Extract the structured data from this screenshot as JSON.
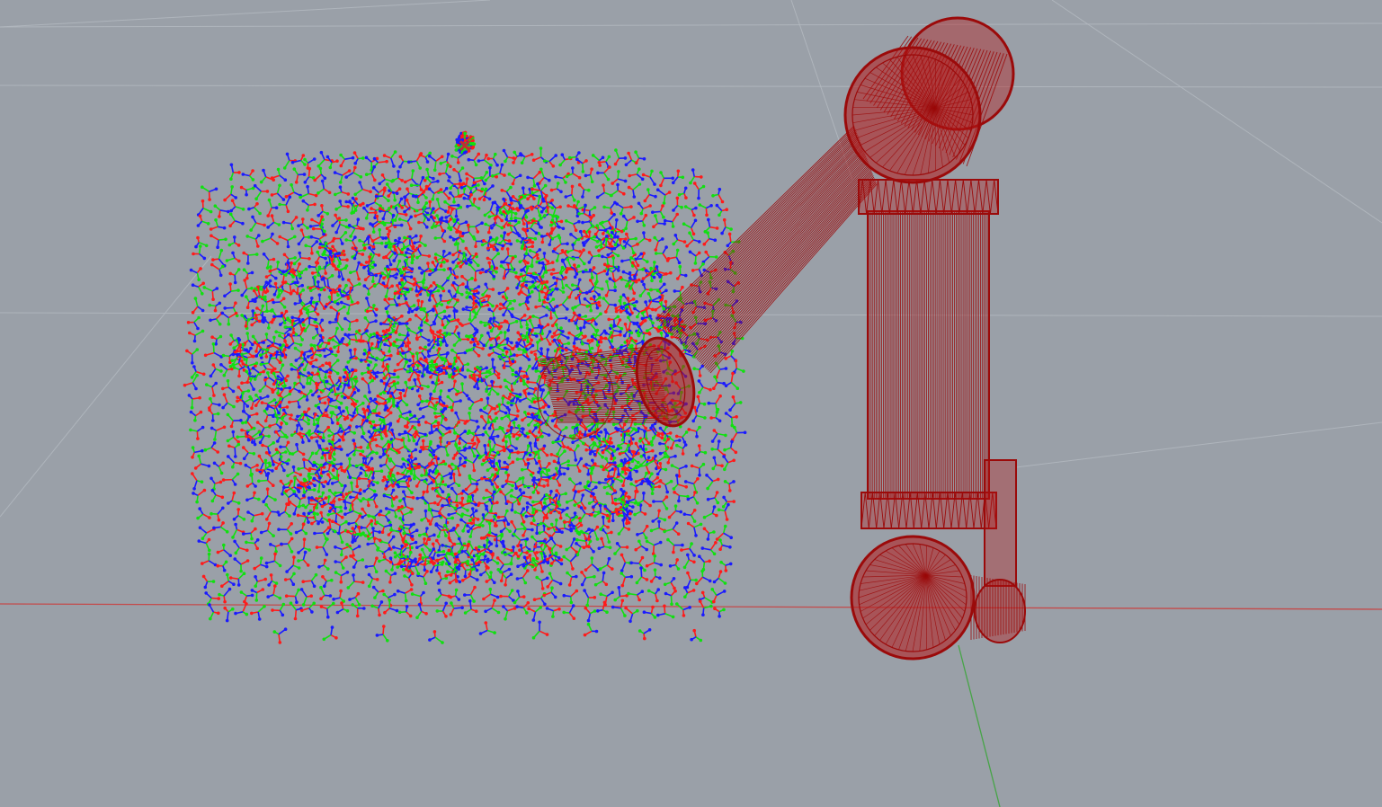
{
  "viewport": {
    "background_color": "#9aa0a8",
    "grid_line_color": "#b3b8bf",
    "x_axis_color": "#c44a4a",
    "y_axis_color": "#47a447"
  },
  "point_cloud": {
    "axis_colors": {
      "x": "#ff1a1a",
      "y": "#10e010",
      "z": "#1a1aff"
    },
    "marker_color": "#c03030"
  },
  "robot": {
    "wire_color": "#9b0a0a",
    "fill_color": "#b51515"
  }
}
